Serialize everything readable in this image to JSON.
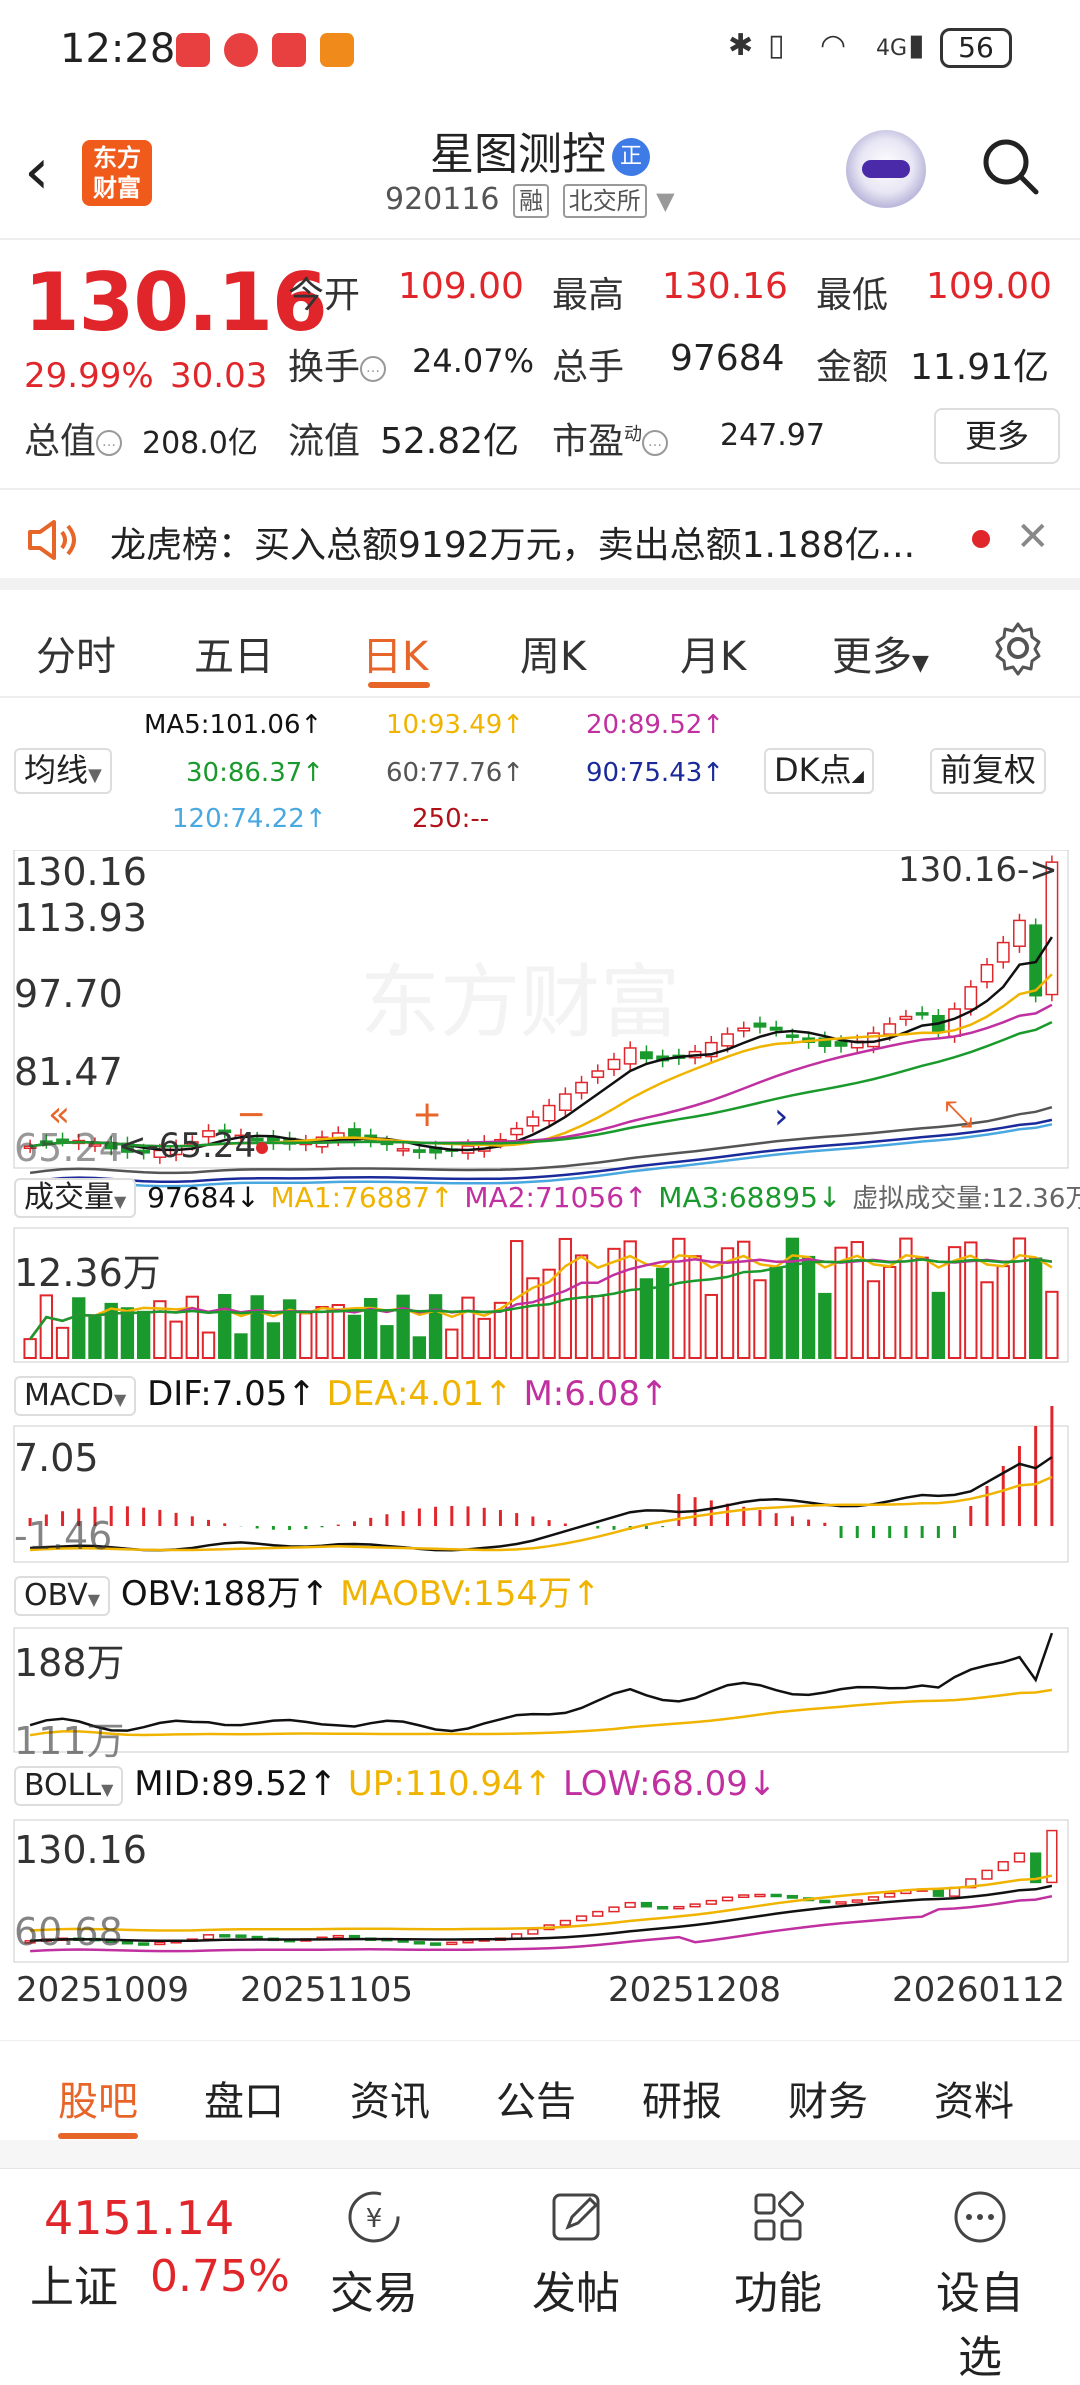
{
  "status_bar": {
    "time": "12:28",
    "network": "4G",
    "battery": "56",
    "app_icons": [
      "app-icon-red",
      "app-icon-weibo",
      "app-icon-red2",
      "app-icon-orange"
    ]
  },
  "header": {
    "title": "星图测控",
    "badge": "正",
    "code": "920116",
    "tag1": "融",
    "tag2": "北交所",
    "logo_line1": "东方",
    "logo_line2": "财富"
  },
  "quote": {
    "price": "130.16",
    "change_pct": "29.99%",
    "change_amt": "30.03",
    "open_label": "今开",
    "open": "109.00",
    "high_label": "最高",
    "high": "130.16",
    "low_label": "最低",
    "low": "109.00",
    "turnover_label": "换手",
    "turnover": "24.07%",
    "volume_label": "总手",
    "volume": "97684",
    "amount_label": "金额",
    "amount": "11.91亿",
    "mcap_label": "总值",
    "mcap": "208.0亿",
    "float_label": "流值",
    "float": "52.82亿",
    "pe_label": "市盈",
    "pe_sup": "动",
    "pe": "247.97",
    "more": "更多"
  },
  "notice": {
    "text": "龙虎榜：买入总额9192万元，卖出总额1.188亿..."
  },
  "tabs": [
    {
      "label": "分时"
    },
    {
      "label": "五日"
    },
    {
      "label": "日K"
    },
    {
      "label": "周K"
    },
    {
      "label": "月K"
    },
    {
      "label": "更多"
    }
  ],
  "ma": {
    "selector": "均线",
    "dk": "DK点",
    "adjust": "前复权",
    "ma5": "MA5:101.06↑",
    "ma10": "10:93.49↑",
    "ma20": "20:89.52↑",
    "ma30": "30:86.37↑",
    "ma60": "60:77.76↑",
    "ma90": "90:75.43↑",
    "ma120": "120:74.22↑",
    "ma250": "250:--"
  },
  "kline": {
    "y_labels": [
      "130.16",
      "113.93",
      "97.70",
      "81.47",
      "65.24"
    ],
    "last_marker": "130.16->",
    "low_marker": "<-65.24"
  },
  "volume": {
    "selector": "成交量",
    "vol": "97684↓",
    "ma1": "MA1:76887↑",
    "ma2": "MA2:71056↑",
    "ma3": "MA3:68895↓",
    "virtual": "虚拟成交量:12.36万",
    "y_label": "12.36万"
  },
  "macd": {
    "selector": "MACD",
    "dif": "DIF:7.05↑",
    "dea": "DEA:4.01↑",
    "m": "M:6.08↑",
    "y_top": "7.05",
    "y_bot": "-1.46"
  },
  "obv": {
    "selector": "OBV",
    "obv": "OBV:188万↑",
    "maobv": "MAOBV:154万↑",
    "y_top": "188万",
    "y_bot": "111万"
  },
  "boll": {
    "selector": "BOLL",
    "mid": "MID:89.52↑",
    "up": "UP:110.94↑",
    "low": "LOW:68.09↓",
    "y_top": "130.16",
    "y_bot": "60.68"
  },
  "dates": [
    "20251009",
    "20251105",
    "20251208",
    "20260112"
  ],
  "subtabs": [
    {
      "label": "股吧"
    },
    {
      "label": "盘口"
    },
    {
      "label": "资讯"
    },
    {
      "label": "公告"
    },
    {
      "label": "研报"
    },
    {
      "label": "财务"
    },
    {
      "label": "资料"
    }
  ],
  "index": {
    "value": "4151.14",
    "name": "上证",
    "pct": "0.75%"
  },
  "bottom_nav": [
    {
      "label": "交易",
      "icon": "yen-trade-icon"
    },
    {
      "label": "发帖",
      "icon": "edit-post-icon"
    },
    {
      "label": "功能",
      "icon": "grid-function-icon"
    },
    {
      "label": "设自选",
      "icon": "more-dots-icon"
    }
  ],
  "colors": {
    "up_red": "#e0262b",
    "down_green": "#1a9a2c",
    "accent": "#e8652a",
    "ma5": "#111111",
    "ma10": "#f0b400",
    "ma20": "#c030a0",
    "ma30": "#1a9a2c",
    "ma60": "#555555",
    "ma90": "#1a2a9a",
    "ma120": "#4aa8e0",
    "ma250": "#b0121a"
  }
}
